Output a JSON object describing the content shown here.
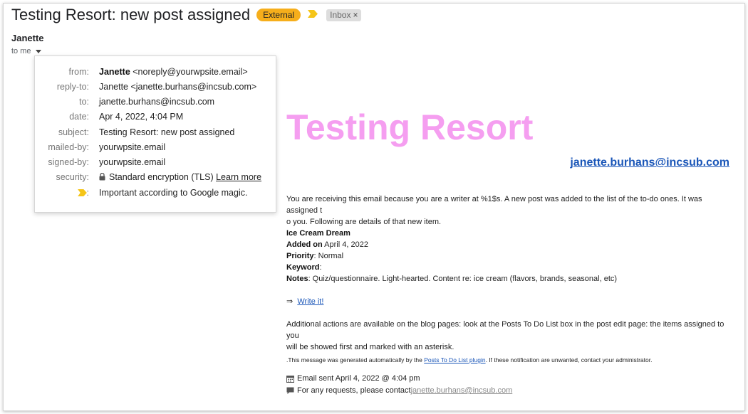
{
  "header": {
    "subject": "Testing Resort: new post assigned",
    "external_label": "External",
    "inbox_label": "Inbox",
    "inbox_close": "×"
  },
  "sender": {
    "name": "Janette",
    "to_me": "to me"
  },
  "details": {
    "from_label": "from:",
    "from_name": "Janette",
    "from_address": " <noreply@yourwpsite.email>",
    "reply_to_label": "reply-to:",
    "reply_to_value": "Janette <janette.burhans@incsub.com>",
    "to_label": "to:",
    "to_value": "janette.burhans@incsub.com",
    "date_label": "date:",
    "date_value": "Apr 4, 2022, 4:04 PM",
    "subject_label": "subject:",
    "subject_value": "Testing Resort: new post assigned",
    "mailed_by_label": "mailed-by:",
    "mailed_by_value": "yourwpsite.email",
    "signed_by_label": "signed-by:",
    "signed_by_value": "yourwpsite.email",
    "security_label": "security:",
    "security_value": "Standard encryption (TLS)",
    "learn_more": "Learn more",
    "important_colon": ":",
    "important_value": "Important according to Google magic."
  },
  "body": {
    "brand_title": "Testing Resort",
    "brand_email": "janette.burhans@incsub.com",
    "intro_line1": "You are receiving this email because you are a writer at %1$s. A new post was added to the list of the to-do ones. It was assigned t",
    "intro_line2": "o you. Following are details of that new item.",
    "item_title": "Ice Cream Dream",
    "added_label": "Added on",
    "added_value": " April 4, 2022",
    "priority_label": "Priority",
    "priority_value": ": Normal",
    "keyword_label": "Keyword",
    "keyword_value": ":",
    "notes_label": "Notes",
    "notes_value": ": Quiz/questionnaire. Light-hearted. Content re: ice cream (flavors, brands, seasonal, etc)",
    "arrow": "⇒",
    "write_it": "Write it!",
    "additional_line1": "Additional actions are available on the blog pages: look at the Posts To Do List box in the post edit page: the items assigned to you",
    "additional_line2": "will be showed first and marked with an asterisk.",
    "auto_prefix": ".This message was generated automatically by the ",
    "plugin_link": "Posts To Do List plugin",
    "auto_suffix": ". If these notification are unwanted, contact your administrator.",
    "sent_line": "Email sent April 4, 2022 @ 4:04 pm",
    "contact_prefix": "For any requests, please contact ",
    "contact_email": "janette.burhans@incsub.com"
  },
  "colors": {
    "external_badge": "#f6ae1b",
    "importance_marker": "#f5c518",
    "brand_pink": "#f59ef0",
    "link_blue": "#1a56b8"
  },
  "icons": {
    "importance": "importance-marker-icon",
    "lock": "lock-icon",
    "calendar": "calendar-icon",
    "comment": "comment-icon",
    "caret": "caret-down-icon"
  }
}
